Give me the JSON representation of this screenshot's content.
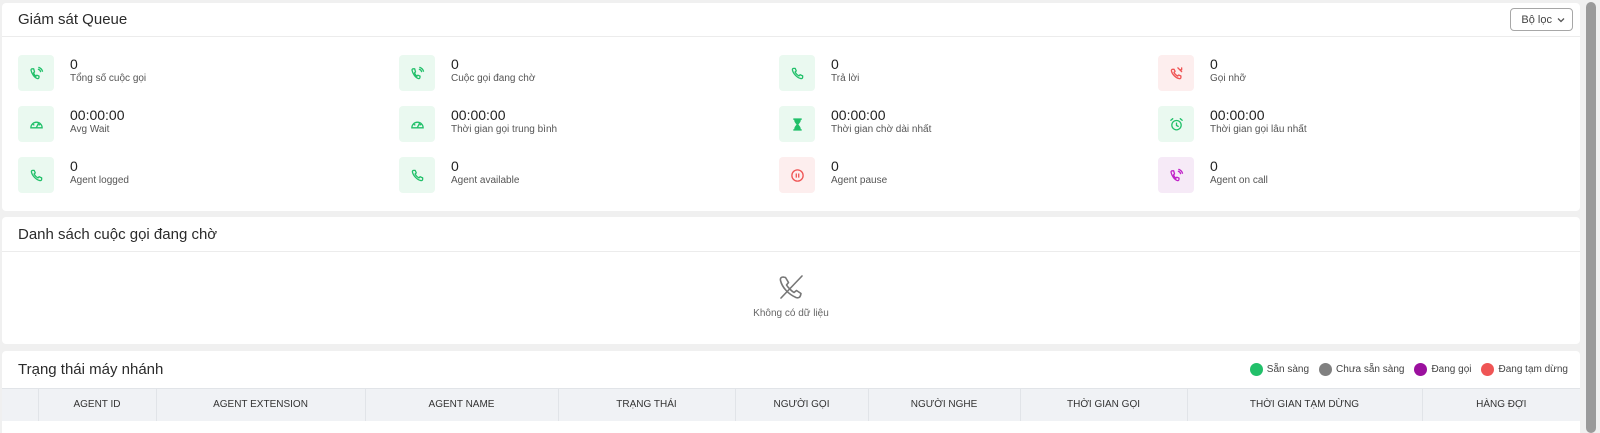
{
  "monitor": {
    "title": "Giám sát Queue",
    "filter_label": "Bộ lọc",
    "stats": [
      {
        "value": "0",
        "label": "Tổng số cuộc gọi",
        "icon": "phone-ringing-icon",
        "color": "green"
      },
      {
        "value": "0",
        "label": "Cuộc gọi đang chờ",
        "icon": "phone-ringing-icon",
        "color": "green"
      },
      {
        "value": "0",
        "label": "Trả lời",
        "icon": "phone-icon",
        "color": "green"
      },
      {
        "value": "0",
        "label": "Gọi nhỡ",
        "icon": "missed-call-icon",
        "color": "red"
      },
      {
        "value": "00:00:00",
        "label": "Avg Wait",
        "icon": "speedometer-icon",
        "color": "green"
      },
      {
        "value": "00:00:00",
        "label": "Thời gian gọi trung bình",
        "icon": "speedometer-icon",
        "color": "green"
      },
      {
        "value": "00:00:00",
        "label": "Thời gian chờ dài nhất",
        "icon": "hourglass-icon",
        "color": "green"
      },
      {
        "value": "00:00:00",
        "label": "Thời gian gọi lâu nhất",
        "icon": "alarm-clock-icon",
        "color": "green"
      },
      {
        "value": "0",
        "label": "Agent logged",
        "icon": "phone-icon",
        "color": "green"
      },
      {
        "value": "0",
        "label": "Agent available",
        "icon": "phone-icon",
        "color": "green"
      },
      {
        "value": "0",
        "label": "Agent pause",
        "icon": "pause-icon",
        "color": "red"
      },
      {
        "value": "0",
        "label": "Agent on call",
        "icon": "phone-ringing-icon",
        "color": "purple"
      }
    ]
  },
  "waiting": {
    "title": "Danh sách cuộc gọi đang chờ",
    "empty_text": "Không có dữ liệu"
  },
  "extensions": {
    "title": "Trạng thái máy nhánh",
    "legend": [
      {
        "label": "Sẵn sàng",
        "color": "#22c06a"
      },
      {
        "label": "Chưa sẵn sàng",
        "color": "#808080"
      },
      {
        "label": "Đang gọi",
        "color": "#9b109e"
      },
      {
        "label": "Đang tạm dừng",
        "color": "#ef5555"
      }
    ],
    "columns": [
      "",
      "AGENT ID",
      "AGENT EXTENSION",
      "AGENT NAME",
      "TRẠNG THÁI",
      "NGƯỜI GỌI",
      "NGƯỜI NGHE",
      "THỜI GIAN GỌI",
      "THỜI GIAN TẠM DỪNG",
      "HÀNG ĐỢI"
    ]
  }
}
